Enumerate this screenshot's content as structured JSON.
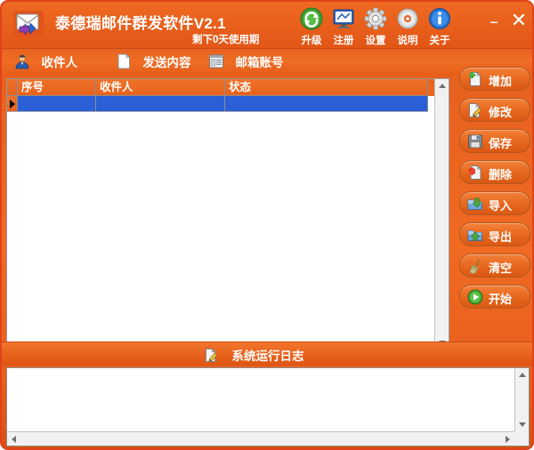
{
  "window": {
    "title": "泰德瑞邮件群发软件V2.1",
    "subtitle": "剩下0天使用期",
    "logo_icon": "envelope-arrows-icon",
    "minimize_label": "–",
    "close_label": "✕",
    "accent_color": "#e8621f",
    "border_color": "#e0431a",
    "selection_color": "#2a5fd8"
  },
  "toolbar": {
    "items": [
      {
        "label": "升级",
        "icon": "refresh-green-icon"
      },
      {
        "label": "注册",
        "icon": "monitor-register-icon"
      },
      {
        "label": "设置",
        "icon": "gear-icon"
      },
      {
        "label": "说明",
        "icon": "disc-help-icon"
      },
      {
        "label": "关于",
        "icon": "info-circle-icon"
      }
    ]
  },
  "tabs": {
    "items": [
      {
        "label": "收件人",
        "icon": "user-person-icon"
      },
      {
        "label": "发送内容",
        "icon": "document-page-icon"
      },
      {
        "label": "邮箱账号",
        "icon": "mailbox-account-icon"
      }
    ]
  },
  "grid": {
    "columns": [
      "序号",
      "收件人",
      "状态"
    ],
    "rows": [
      {
        "selected": true,
        "cells": [
          "",
          "",
          ""
        ]
      }
    ],
    "row_indicator": "current-row-caret"
  },
  "side_buttons": {
    "items": [
      {
        "label": "增加",
        "icon": "add-page-icon"
      },
      {
        "label": "修改",
        "icon": "edit-pencil-icon"
      },
      {
        "label": "保存",
        "icon": "floppy-save-icon"
      },
      {
        "label": "删除",
        "icon": "delete-cross-icon"
      },
      {
        "label": "导入",
        "icon": "import-arrow-icon"
      },
      {
        "label": "导出",
        "icon": "export-arrow-icon"
      },
      {
        "label": "清空",
        "icon": "broom-clear-icon"
      },
      {
        "label": "开始",
        "icon": "play-start-icon"
      }
    ]
  },
  "log": {
    "header_label": "系统运行日志",
    "header_icon": "log-document-icon",
    "content": ""
  }
}
